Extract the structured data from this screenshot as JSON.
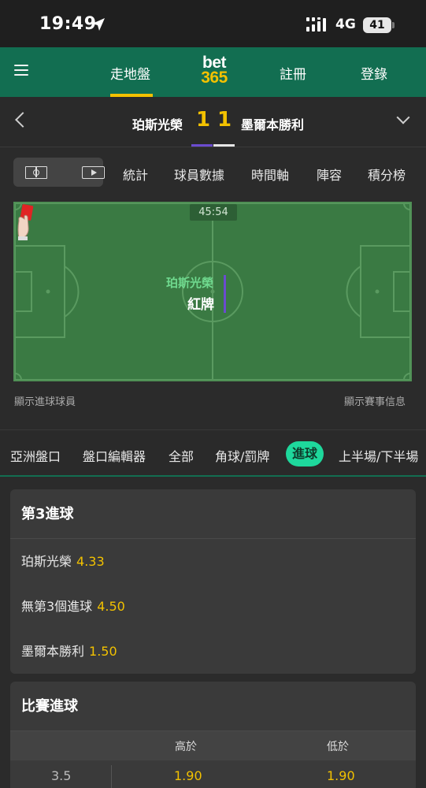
{
  "status_bar": {
    "time": "19:49",
    "network": "4G",
    "battery": "41"
  },
  "nav": {
    "in_play": "走地盤",
    "logo_top": "bet",
    "logo_bottom": "365",
    "join": "註冊",
    "login": "登錄"
  },
  "match": {
    "home_team": "珀斯光榮",
    "home_score": "1",
    "away_score": "1",
    "away_team": "墨爾本勝利"
  },
  "tools": {
    "tabs": [
      "統計",
      "球員數據",
      "時間軸",
      "陣容",
      "積分榜"
    ]
  },
  "pitch": {
    "clock": "45:54",
    "event_team": "珀斯光榮",
    "event_type": "紅牌",
    "show_scorers": "顯示進球球員",
    "show_match_info": "顯示賽事信息"
  },
  "filters": {
    "tabs": [
      "亞洲盤口",
      "盤口編輯器",
      "全部",
      "角球/罰牌",
      "進球",
      "上半場/下半場"
    ],
    "active": "進球"
  },
  "third_goal": {
    "title": "第3進球",
    "rows": [
      {
        "label": "珀斯光榮",
        "odds": "4.33"
      },
      {
        "label": "無第3個進球",
        "odds": "4.50"
      },
      {
        "label": "墨爾本勝利",
        "odds": "1.50"
      }
    ]
  },
  "match_goals": {
    "title": "比賽進球",
    "over_label": "高於",
    "under_label": "低於",
    "rows": [
      {
        "line": "3.5",
        "over": "1.90",
        "under": "1.90"
      }
    ]
  },
  "colors": {
    "brand_green": "#126e51",
    "accent_yellow": "#f2c100",
    "active_pill": "#1ed89c",
    "home_color": "#6b4bcf",
    "pitch_green": "#3a7a43"
  }
}
